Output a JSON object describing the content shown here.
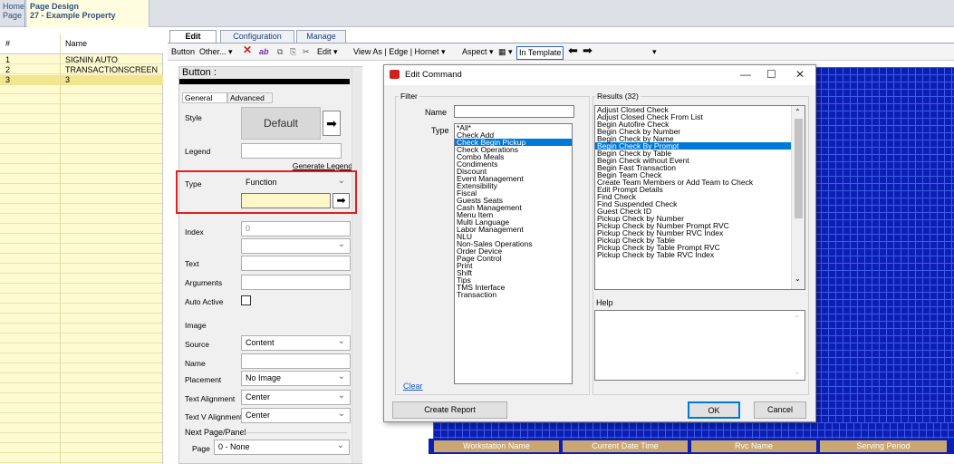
{
  "breadcrumb": {
    "home": "Home Page",
    "page_title": "Page Design",
    "page_sub": "27 - Example Property"
  },
  "left_list": {
    "col_num": "#",
    "col_name": "Name",
    "rows": [
      {
        "num": "1",
        "name": "SIGNIN AUTO"
      },
      {
        "num": "2",
        "name": "TRANSACTIONSCREEN AU..."
      },
      {
        "num": "3",
        "name": "3"
      }
    ]
  },
  "tabs": [
    "Edit",
    "Configuration",
    "Manage"
  ],
  "toolbar": {
    "button": "Button",
    "other": "Other... ▾",
    "ab": "ab",
    "edit": "Edit ▾",
    "view_as": "View As | Edge | Hornet ▾",
    "aspect": "Aspect ▾",
    "grid": "▦ ▾",
    "in_template": "In Template",
    "arrow_dd": "▾"
  },
  "props": {
    "header": "Button :",
    "header2": "Button",
    "tab_general": "General",
    "tab_advanced": "Advanced",
    "style_label": "Style",
    "style_value": "Default",
    "legend_label": "Legend",
    "generate_legend": "Generate Legend",
    "type_label": "Type",
    "type_value": "Function",
    "index_label": "Index",
    "index_value": "0",
    "text_label": "Text",
    "arguments_label": "Arguments",
    "auto_active_label": "Auto Active",
    "image_label": "Image",
    "source_label": "Source",
    "source_value": "Content",
    "name_label": "Name",
    "placement_label": "Placement",
    "placement_value": "No Image",
    "text_align_label": "Text Alignment",
    "text_align_value": "Center",
    "text_valign_label": "Text V Alignment",
    "text_valign_value": "Center",
    "next_page_label": "Next Page/Panel",
    "page_label": "Page",
    "page_value": "0 - None"
  },
  "dialog": {
    "title": "Edit Command",
    "min": "—",
    "max": "☐",
    "close": "✕",
    "filter_label": "Filter",
    "name_label": "Name",
    "type_label": "Type",
    "types": [
      "*All*",
      "Check Add",
      "Check Begin Pickup",
      "Check Operations",
      "Combo Meals",
      "Condiments",
      "Discount",
      "Event Management",
      "Extensibility",
      "Fiscal",
      "Guests Seats",
      "Cash Management",
      "Menu Item",
      "Multi Language",
      "Labor Management",
      "NLU",
      "Non-Sales Operations",
      "Order Device",
      "Page Control",
      "Print",
      "Shift",
      "Tips",
      "TMS Interface",
      "Transaction"
    ],
    "types_selected": 2,
    "results_label": "Results (32)",
    "results": [
      "Adjust Closed Check",
      "Adjust Closed Check From List",
      "Begin Autofire Check",
      "Begin Check by Number",
      "Begin Check by Name",
      "Begin Check By Prompt",
      "Begin Check by Table",
      "Begin Check without Event",
      "Begin Fast Transaction",
      "Begin Team Check",
      "Create Team Members or Add Team to Check",
      "Edit Prompt Details",
      "Find Check",
      "Find Suspended Check",
      "Guest Check ID",
      "Pickup Check by Number",
      "Pickup Check by Number Prompt RVC",
      "Pickup Check by Number RVC Index",
      "Pickup Check by Table",
      "Pickup Check by Table Prompt RVC",
      "Pickup Check by Table RVC Index"
    ],
    "results_selected": 5,
    "help_label": "Help",
    "clear_link": "Clear",
    "create_report": "Create Report",
    "ok": "OK",
    "cancel": "Cancel"
  },
  "footer_cells": [
    "Workstation Name",
    "Current Date Time",
    "Rvc Name",
    "Serving Period"
  ]
}
